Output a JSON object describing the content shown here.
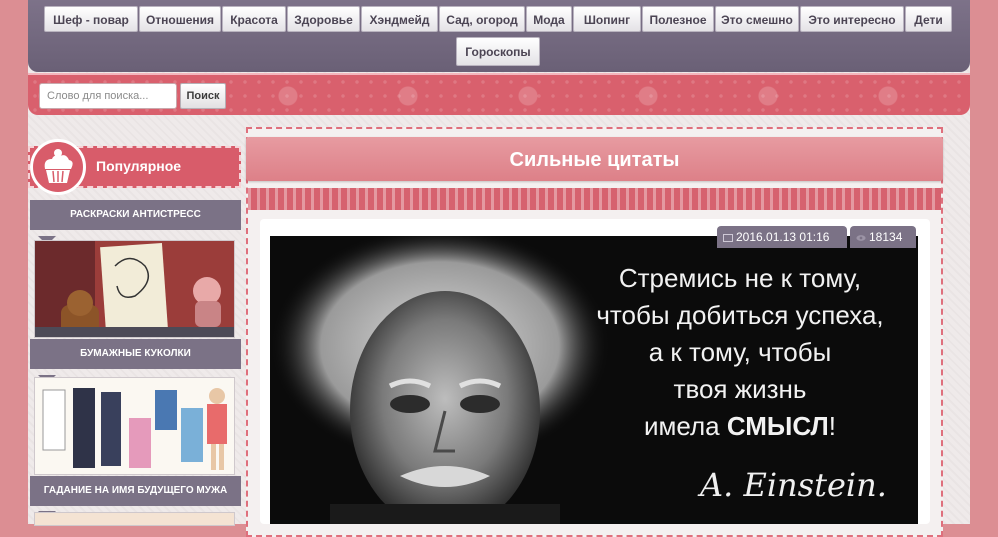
{
  "nav": {
    "items": [
      "Шеф - повар",
      "Отношения",
      "Красота",
      "Здоровье",
      "Хэндмейд",
      "Сад, огород",
      "Мода",
      "Шопинг",
      "Полезное",
      "Это смешно",
      "Это интересно",
      "Дети",
      "Гороскопы"
    ]
  },
  "search": {
    "placeholder": "Слово для поиска...",
    "button_label": "Поиск"
  },
  "sidebar": {
    "title": "Популярное",
    "items": [
      {
        "label": "РАСКРАСКИ АНТИСТРЕСС"
      },
      {
        "label": "БУМАЖНЫЕ КУКОЛКИ"
      },
      {
        "label": "ГАДАНИЕ НА ИМЯ БУДУЩЕГО МУЖА"
      }
    ]
  },
  "post": {
    "title": "Сильные цитаты",
    "date": "2016.01.13 01:16",
    "views": "18134",
    "quote_lines": [
      "Стремись не к тому,",
      "чтобы добиться успеха,",
      "а к тому, чтобы",
      "твоя жизнь"
    ],
    "quote_last_prefix": "имела ",
    "quote_last_strong": "СМЫСЛ",
    "quote_last_suffix": "!",
    "signature": "A. Einstein."
  },
  "colors": {
    "accent": "#d85c6a",
    "nav": "#7b7286",
    "page_bg": "#dc8e93"
  }
}
